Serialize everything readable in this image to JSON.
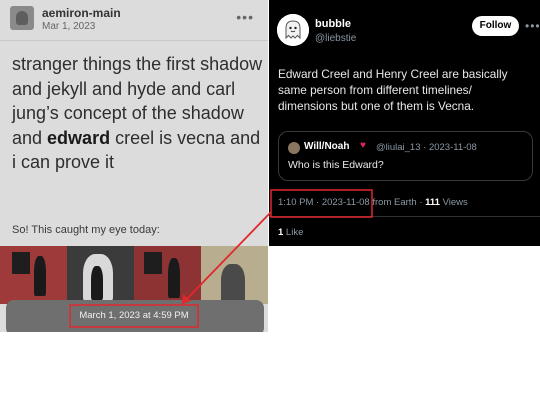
{
  "left_post": {
    "username": "aemiron-main",
    "date": "Mar 1, 2023",
    "text_part1": "stranger things the first shadow and jekyll and hyde and carl jung’s concept of the shadow and ",
    "text_bold": "edward",
    "text_part2": " creel is vecna and i can prove it",
    "caption": "So! This caught my eye today:",
    "timestamp": "March 1, 2023 at 4:59 PM"
  },
  "tweet": {
    "display_name": "bubble",
    "handle": "@liebstie",
    "follow_label": "Follow",
    "text": "Edward Creel and Henry Creel are basically same person from different timelines/ dimensions but one of them is Vecna.",
    "quote": {
      "display_name": "Will/Noah",
      "handle_date": "@liulai_13 · 2023-11-08",
      "text": "Who is this Edward?"
    },
    "time_date": "1:10 PM · 2023-11-08",
    "source": " from Earth · ",
    "views_count": "111",
    "views_label": " Views",
    "likes_count": "1",
    "likes_label": " Like"
  },
  "icons": {
    "more": "more-horizontal-icon",
    "heart": "heart-icon",
    "avatar": "avatar"
  },
  "colors": {
    "annotation": "#e0282e",
    "follow_bg": "#ffffff",
    "dark_bg": "#000000",
    "muted_text": "#8b98a5"
  }
}
